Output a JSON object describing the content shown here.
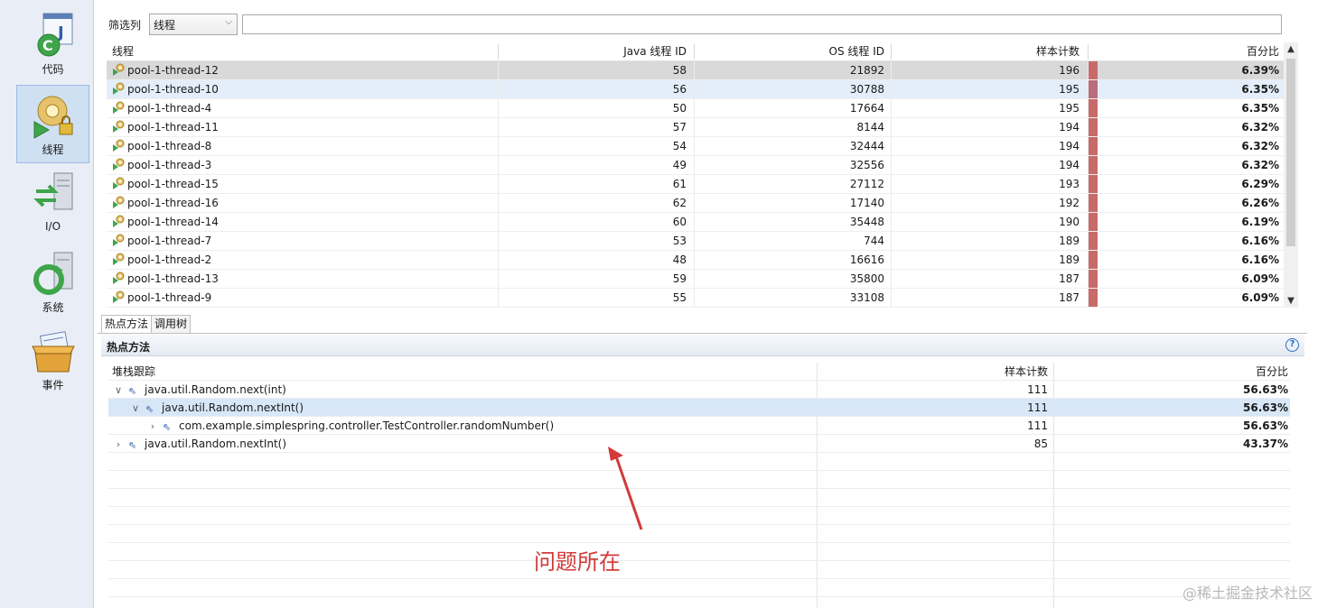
{
  "sidebar": {
    "items": [
      {
        "label": "代码",
        "icon": "code-icon"
      },
      {
        "label": "线程",
        "icon": "threads-icon",
        "active": true
      },
      {
        "label": "I/O",
        "icon": "io-icon"
      },
      {
        "label": "系统",
        "icon": "system-icon"
      },
      {
        "label": "事件",
        "icon": "events-icon"
      }
    ]
  },
  "filter": {
    "label": "筛选列",
    "selected": "线程",
    "value": ""
  },
  "threads": {
    "headers": {
      "name": "线程",
      "java_id": "Java 线程 ID",
      "os_id": "OS 线程 ID",
      "count": "样本计数",
      "pct": "百分比"
    },
    "rows": [
      {
        "name": "pool-1-thread-12",
        "java_id": "58",
        "os_id": "21892",
        "count": "196",
        "pct": "6.39%"
      },
      {
        "name": "pool-1-thread-10",
        "java_id": "56",
        "os_id": "30788",
        "count": "195",
        "pct": "6.35%"
      },
      {
        "name": "pool-1-thread-4",
        "java_id": "50",
        "os_id": "17664",
        "count": "195",
        "pct": "6.35%"
      },
      {
        "name": "pool-1-thread-11",
        "java_id": "57",
        "os_id": "8144",
        "count": "194",
        "pct": "6.32%"
      },
      {
        "name": "pool-1-thread-8",
        "java_id": "54",
        "os_id": "32444",
        "count": "194",
        "pct": "6.32%"
      },
      {
        "name": "pool-1-thread-3",
        "java_id": "49",
        "os_id": "32556",
        "count": "194",
        "pct": "6.32%"
      },
      {
        "name": "pool-1-thread-15",
        "java_id": "61",
        "os_id": "27112",
        "count": "193",
        "pct": "6.29%"
      },
      {
        "name": "pool-1-thread-16",
        "java_id": "62",
        "os_id": "17140",
        "count": "192",
        "pct": "6.26%"
      },
      {
        "name": "pool-1-thread-14",
        "java_id": "60",
        "os_id": "35448",
        "count": "190",
        "pct": "6.19%"
      },
      {
        "name": "pool-1-thread-7",
        "java_id": "53",
        "os_id": "744",
        "count": "189",
        "pct": "6.16%"
      },
      {
        "name": "pool-1-thread-2",
        "java_id": "48",
        "os_id": "16616",
        "count": "189",
        "pct": "6.16%"
      },
      {
        "name": "pool-1-thread-13",
        "java_id": "59",
        "os_id": "35800",
        "count": "187",
        "pct": "6.09%"
      },
      {
        "name": "pool-1-thread-9",
        "java_id": "55",
        "os_id": "33108",
        "count": "187",
        "pct": "6.09%"
      }
    ]
  },
  "tabs": [
    {
      "label": "热点方法",
      "active": true
    },
    {
      "label": "调用树"
    }
  ],
  "hot_methods": {
    "title": "热点方法",
    "headers": {
      "trace": "堆栈跟踪",
      "count": "样本计数",
      "pct": "百分比"
    },
    "rows": [
      {
        "trace": "java.util.Random.next(int)",
        "count": "111",
        "pct": "56.63%",
        "level": 0,
        "expanded": true
      },
      {
        "trace": "java.util.Random.nextInt()",
        "count": "111",
        "pct": "56.63%",
        "level": 1,
        "expanded": true,
        "selected": true
      },
      {
        "trace": "com.example.simplespring.controller.TestController.randomNumber()",
        "count": "111",
        "pct": "56.63%",
        "level": 2,
        "expanded": false
      },
      {
        "trace": "java.util.Random.nextInt()",
        "count": "85",
        "pct": "43.37%",
        "level": 0,
        "expanded": false
      }
    ]
  },
  "annotation": {
    "text": "问题所在",
    "color": "#d23a3a"
  },
  "watermark": "@稀土掘金技术社区",
  "colors": {
    "bar": "#c96a6a",
    "selection": "#d7e7f8",
    "accent": "#2a6bc2"
  }
}
